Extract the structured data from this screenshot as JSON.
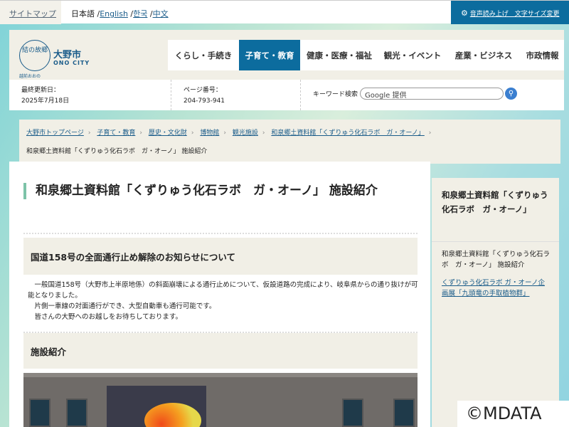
{
  "topbar": {
    "sitemap": "サイトマップ",
    "lang_current": "日本語",
    "langs": [
      "English",
      "한국",
      "中文"
    ],
    "accessibility": "音声読み上げ　文字サイズ変更"
  },
  "header": {
    "logo_text": "結の故郷",
    "logo_sub": "越前おおの",
    "city_name": "大野市",
    "city_name_en": "ONO CITY",
    "nav": [
      "くらし・手続き",
      "子育て・教育",
      "健康・医療・福祉",
      "観光・イベント",
      "産業・ビジネス",
      "市政情報"
    ],
    "updated_label": "最終更新日：",
    "updated_value": "2025年7月18日",
    "page_no_label": "ページ番号：",
    "page_no_value": "204-793-941",
    "search_label": "キーワード検索",
    "search_placeholder": "Google 提供"
  },
  "breadcrumb": {
    "links": [
      "大野市トップページ",
      "子育て・教育",
      "歴史・文化財",
      "博物館",
      "観光施設",
      "和泉郷土資料館「くずりゅう化石ラボ　ガ・オーノ」"
    ],
    "current": "和泉郷土資料館「くずりゅう化石ラボ　ガ・オーノ」 施設紹介"
  },
  "main": {
    "title": "和泉郷土資料館「くずりゅう化石ラボ　ガ・オーノ」 施設紹介",
    "notice_heading": "国道158号の全面通行止め解除のお知らせについて",
    "notice_body": [
      "　一般国道158号（大野市上半原地係）の斜面崩壊による通行止めについて、仮設道路の完成により、岐阜県からの通り抜けが可能となりました。",
      "　片側一車線の対面通行ができ、大型自動車も通行可能です。",
      "　皆さんの大野へのお越しをお待ちしております。"
    ],
    "section_heading": "施設紹介"
  },
  "sidebar": {
    "heading": "和泉郷土資料館「くずりゅう化石ラボ　ガ・オーノ」",
    "items": [
      "和泉郷土資料館「くずりゅう化石ラボ　ガ・オーノ」 施設紹介",
      "くずりゅう化石ラボ ガ・オーノ企画展「九頭竜の手取植物群」"
    ]
  },
  "watermark": "©MDATA"
}
